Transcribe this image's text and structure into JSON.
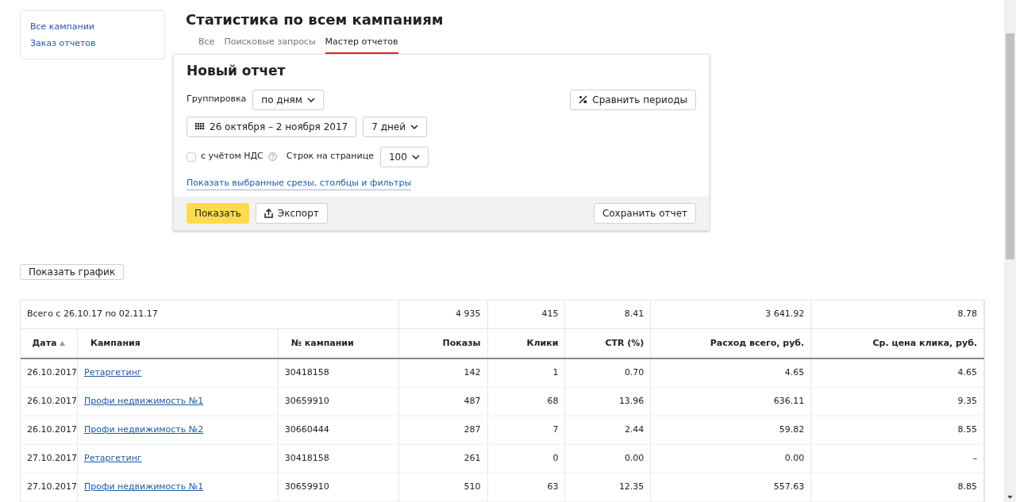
{
  "sidebar": {
    "links": [
      "Все кампании",
      "Заказ отчетов"
    ]
  },
  "page_title": "Статистика по всем кампаниям",
  "tabs": [
    {
      "label": "Все",
      "selected": false
    },
    {
      "label": "Поисковые запросы",
      "selected": false
    },
    {
      "label": "Мастер отчетов",
      "selected": true
    }
  ],
  "report": {
    "title": "Новый отчет",
    "grouping_label": "Группировка",
    "grouping_value": "по дням",
    "compare_button": "Сравнить периоды",
    "date_range": "26 октября – 2 ноября 2017",
    "period": "7 дней",
    "vat": {
      "label": "с учётом НДС",
      "checked": false
    },
    "rows_label": "Строк на странице",
    "rows_value": "100",
    "filters_link": "Показать выбранные срезы, столбцы и фильтры",
    "show_button": "Показать",
    "export_button": "Экспорт",
    "save_button": "Сохранить отчет"
  },
  "chart_button": "Показать график",
  "table": {
    "total_label": "Всего с 26.10.17 по 02.11.17",
    "totals": [
      "4 935",
      "415",
      "8.41",
      "3 641.92",
      "8.78"
    ],
    "columns": [
      {
        "label": "Дата",
        "sorted": true
      },
      {
        "label": "Кампания",
        "sorted": false
      },
      {
        "label": "№ кампании",
        "sorted": false
      },
      {
        "label": "Показы",
        "sorted": false
      },
      {
        "label": "Клики",
        "sorted": false
      },
      {
        "label": "CTR (%)",
        "sorted": false
      },
      {
        "label": "Расход всего, руб.",
        "sorted": false
      },
      {
        "label": "Ср. цена клика, руб.",
        "sorted": false
      }
    ],
    "rows": [
      [
        "26.10.2017",
        "Ретаргетинг",
        "30418158",
        "142",
        "1",
        "0.70",
        "4.65",
        "4.65"
      ],
      [
        "26.10.2017",
        "Профи недвижимость №1",
        "30659910",
        "487",
        "68",
        "13.96",
        "636.11",
        "9.35"
      ],
      [
        "26.10.2017",
        "Профи недвижимость №2",
        "30660444",
        "287",
        "7",
        "2.44",
        "59.82",
        "8.55"
      ],
      [
        "27.10.2017",
        "Ретаргетинг",
        "30418158",
        "261",
        "0",
        "0.00",
        "0.00",
        "–"
      ],
      [
        "27.10.2017",
        "Профи недвижимость №1",
        "30659910",
        "510",
        "63",
        "12.35",
        "557.63",
        "8.85"
      ]
    ]
  }
}
